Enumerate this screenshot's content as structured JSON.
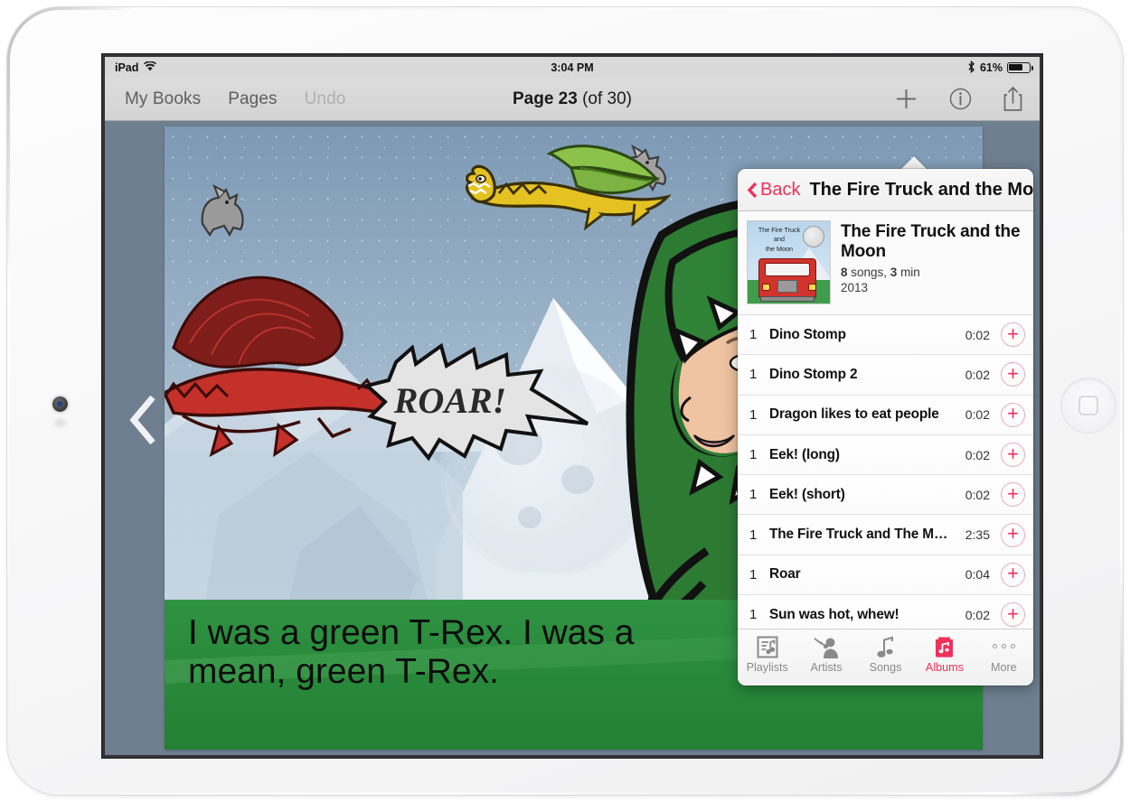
{
  "device": {
    "name": "ipad",
    "home_button": "home-button",
    "camera": "front-camera"
  },
  "status_bar": {
    "carrier": "iPad",
    "wifi_icon": "wifi-icon",
    "time": "3:04 PM",
    "bluetooth_icon": "bluetooth-icon",
    "battery_percent": "61%",
    "battery_level": 61
  },
  "toolbar": {
    "my_books": "My Books",
    "pages": "Pages",
    "undo": "Undo",
    "title_bold": "Page 23",
    "title_rest": " (of 30)",
    "add_icon": "plus-icon",
    "info_icon": "info-icon",
    "share_icon": "share-icon"
  },
  "book": {
    "caption": "I was a green T-Rex. I was a mean, green T-Rex.",
    "speech_bubble": "ROAR!",
    "prev_page_icon": "chevron-left-icon"
  },
  "popover": {
    "back_label": "Back",
    "back_icon": "chevron-left-icon",
    "title": "The Fire Truck and the Moon",
    "album": {
      "artwork_title_lines": [
        "The Fire Truck",
        "and",
        "the Moon"
      ],
      "name": "The Fire Truck and the Moon",
      "songs_count": "8",
      "songs_word": " songs, ",
      "duration": "3",
      "duration_word": " min",
      "year": "2013"
    },
    "songs": [
      {
        "num": "1",
        "title": "Dino Stomp",
        "time": "0:02",
        "add_icon": "plus-circle-icon"
      },
      {
        "num": "1",
        "title": "Dino Stomp 2",
        "time": "0:02",
        "add_icon": "plus-circle-icon"
      },
      {
        "num": "1",
        "title": "Dragon likes to eat people",
        "time": "0:02",
        "add_icon": "plus-circle-icon"
      },
      {
        "num": "1",
        "title": "Eek! (long)",
        "time": "0:02",
        "add_icon": "plus-circle-icon"
      },
      {
        "num": "1",
        "title": "Eek! (short)",
        "time": "0:02",
        "add_icon": "plus-circle-icon"
      },
      {
        "num": "1",
        "title": "The Fire Truck and The M…",
        "time": "2:35",
        "add_icon": "plus-circle-icon"
      },
      {
        "num": "1",
        "title": "Roar",
        "time": "0:04",
        "add_icon": "plus-circle-icon"
      },
      {
        "num": "1",
        "title": "Sun was hot, whew!",
        "time": "0:02",
        "add_icon": "plus-circle-icon"
      }
    ],
    "tabs": [
      {
        "label": "Playlists",
        "icon": "playlists-icon",
        "selected": false
      },
      {
        "label": "Artists",
        "icon": "artists-icon",
        "selected": false
      },
      {
        "label": "Songs",
        "icon": "songs-icon",
        "selected": false
      },
      {
        "label": "Albums",
        "icon": "albums-icon",
        "selected": true
      },
      {
        "label": "More",
        "icon": "more-icon",
        "selected": false
      }
    ]
  },
  "colors": {
    "accent_pink": "#f0305a",
    "toolbar_gray": "#d4d4d4",
    "status_gray": "#d9d9d9",
    "stage_slate": "#6f7f90",
    "grass_green": "#2f9242",
    "sky_blue": "#9cb4c9"
  }
}
